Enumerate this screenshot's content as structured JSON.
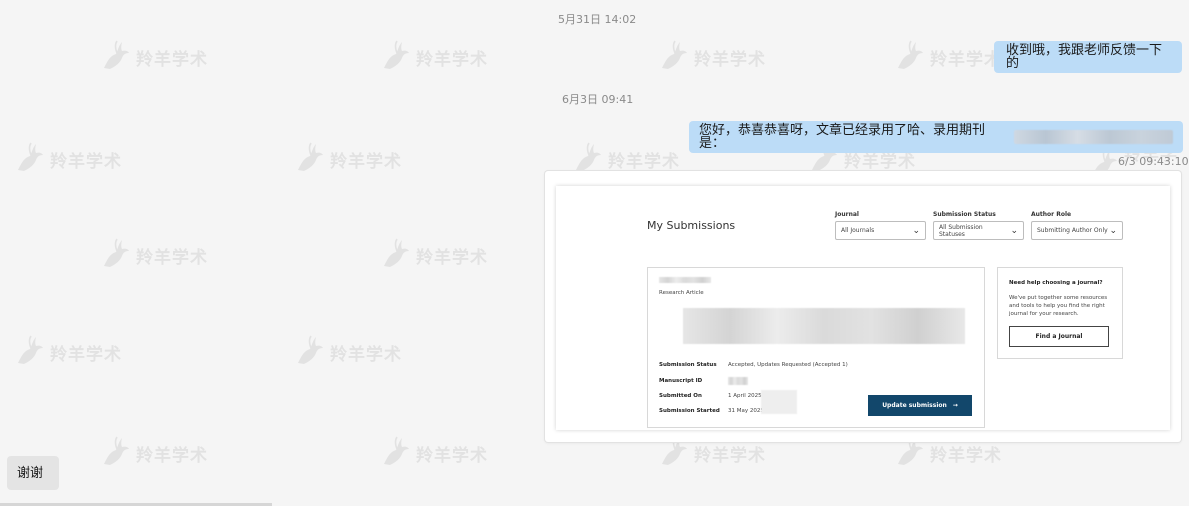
{
  "watermark": {
    "text": "羚羊学术",
    "icon": "antelope-icon"
  },
  "chat": {
    "timestamp_1": "5月31日 14:02",
    "message_1": "收到哦，我跟老师反馈一下的",
    "timestamp_2": "6月3日 09:41",
    "message_2": "您好，恭喜恭喜呀，文章已经录用了哈、录用期刊是：",
    "message_2_time": "6/3 09:43:10",
    "message_3": "谢谢"
  },
  "screenshot": {
    "title": "My Submissions",
    "filters": {
      "journal_label": "Journal",
      "journal_value": "All Journals",
      "status_label": "Submission Status",
      "status_value": "All Submission Statuses",
      "role_label": "Author Role",
      "role_value": "Submitting Author Only"
    },
    "submission": {
      "article_type": "Research Article",
      "status_label": "Submission Status",
      "status_value": "Accepted, Updates Requested (Accepted 1)",
      "manuscript_label": "Manuscript ID",
      "submitted_on_label": "Submitted On",
      "submitted_on_value": "1 April 2025 (",
      "started_label": "Submission Started",
      "started_value": "31 May 2025",
      "update_button": "Update submission",
      "update_icon": "arrow-right-icon"
    },
    "help": {
      "title": "Need help choosing a journal?",
      "body": "We've put together some resources and tools to help you find the right journal for your research.",
      "button": "Find a Journal"
    }
  },
  "colors": {
    "my_bubble": "#bcdcf7",
    "other_bubble": "#e4e4e4",
    "update_button": "#12476b"
  }
}
